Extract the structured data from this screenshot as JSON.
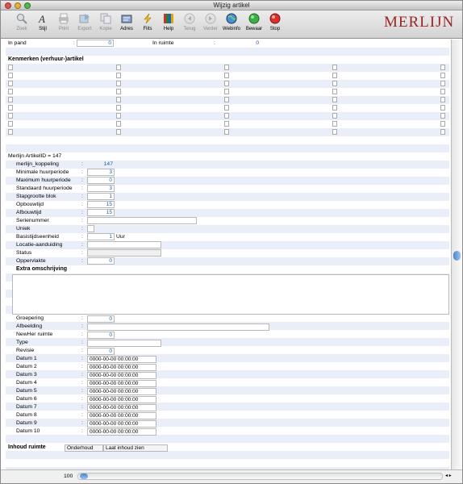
{
  "window": {
    "title": "Wijzig artikel"
  },
  "toolbar": {
    "buttons": [
      {
        "label": "Zoek",
        "enabled": false,
        "icon": "search-icon"
      },
      {
        "label": "Stijl",
        "enabled": true,
        "icon": "style-icon"
      },
      {
        "label": "Print",
        "enabled": false,
        "icon": "print-icon"
      },
      {
        "label": "Export",
        "enabled": false,
        "icon": "export-icon"
      },
      {
        "label": "Kopie",
        "enabled": false,
        "icon": "copy-icon"
      },
      {
        "label": "Adres",
        "enabled": true,
        "icon": "address-icon"
      },
      {
        "label": "Flits",
        "enabled": true,
        "icon": "flash-icon"
      },
      {
        "label": "Help",
        "enabled": true,
        "icon": "help-icon"
      },
      {
        "label": "Terug",
        "enabled": false,
        "icon": "back-icon"
      },
      {
        "label": "Verder",
        "enabled": false,
        "icon": "forward-icon"
      },
      {
        "label": "Webinfo",
        "enabled": true,
        "icon": "globe-icon"
      },
      {
        "label": "Bewaar",
        "enabled": true,
        "icon": "save-icon"
      },
      {
        "label": "Stop",
        "enabled": true,
        "icon": "stop-icon"
      }
    ],
    "logo": "MERLIJN"
  },
  "top": {
    "in_pand_label": "In pand",
    "in_pand_value": "0",
    "in_ruimte_label": "In ruimte",
    "in_ruimte_value": "0",
    "colon": ":"
  },
  "kenmerken": {
    "title": "Kenmerken (verhuur-)artikel"
  },
  "artikel": {
    "id_line": "Merlijn ArtikelID = 147",
    "fields": [
      {
        "label": "merlijn_koppeling",
        "value": "147"
      },
      {
        "label": "Minimale huurperiode",
        "value": "3"
      },
      {
        "label": "Maximum huurperiode",
        "value": "0"
      },
      {
        "label": "Standaard huurperiode",
        "value": "3"
      },
      {
        "label": "Stapgrootte blok",
        "value": "1"
      },
      {
        "label": "Opbouwtijd",
        "value": "15"
      },
      {
        "label": "Afbouwtijd",
        "value": "15"
      },
      {
        "label": "Serienummer",
        "value": ""
      },
      {
        "label": "Uniek",
        "value": ""
      },
      {
        "label": "Basistijdseenheid",
        "value": "1"
      },
      {
        "label": "Locatie-aanduiding",
        "value": ""
      },
      {
        "label": "Status",
        "value": ""
      },
      {
        "label": "Oppervlakte",
        "value": "0"
      }
    ],
    "unit": "Uur"
  },
  "extra": {
    "title": "Extra omschrijving"
  },
  "lower": {
    "fields": [
      {
        "label": "Groepering",
        "value": "0"
      },
      {
        "label": "Afbeelding",
        "value": ""
      },
      {
        "label": "NewHer ruimte",
        "value": "0"
      },
      {
        "label": "Type",
        "value": ""
      },
      {
        "label": "Revisie",
        "value": "0"
      }
    ]
  },
  "dates": [
    {
      "label": "Datum 1",
      "value": "0000-00-00 00:00:00"
    },
    {
      "label": "Datum 2",
      "value": "0000-00-00 00:00:00"
    },
    {
      "label": "Datum 3",
      "value": "0000-00-00 00:00:00"
    },
    {
      "label": "Datum 4",
      "value": "0000-00-00 00:00:00"
    },
    {
      "label": "Datum 5",
      "value": "0000-00-00 00:00:00"
    },
    {
      "label": "Datum 6",
      "value": "0000-00-00 00:00:00"
    },
    {
      "label": "Datum 7",
      "value": "0000-00-00 00:00:00"
    },
    {
      "label": "Datum 8",
      "value": "0000-00-00 00:00:00"
    },
    {
      "label": "Datum 9",
      "value": "0000-00-00 00:00:00"
    },
    {
      "label": "Datum 10",
      "value": "0000-00-00 00:00:00"
    }
  ],
  "inhoud": {
    "label": "Inhoud ruimte",
    "button1": "Onderhoud",
    "button2": "Laat inhoud zien"
  },
  "status_bar": {
    "zoom": "100"
  }
}
